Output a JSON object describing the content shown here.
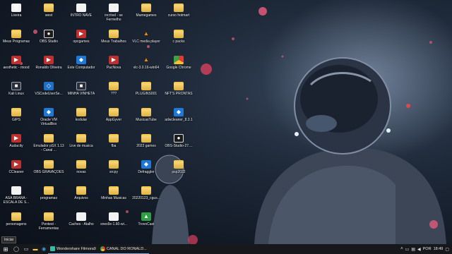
{
  "desktop": {
    "icons": [
      {
        "label": "Lixeira",
        "type": "file",
        "glyph": "🗑"
      },
      {
        "label": "Meus Programas",
        "type": "folder"
      },
      {
        "label": "aesthetic - mood",
        "type": "app-red"
      },
      {
        "label": "Kali Linux",
        "type": "app-dark"
      },
      {
        "label": "GIPS",
        "type": "folder"
      },
      {
        "label": "Audacity",
        "type": "app-red"
      },
      {
        "label": "CCleaner",
        "type": "app-red"
      },
      {
        "label": "ASA BRANA - ESCALA DE S...",
        "type": "file"
      },
      {
        "label": "personagens",
        "type": "folder"
      },
      {
        "label": "west",
        "type": "folder"
      },
      {
        "label": "OBS Studio",
        "type": "obs"
      },
      {
        "label": "Ronaldo Oliveira",
        "type": "app-red"
      },
      {
        "label": "VSCodeUserSe...",
        "type": "vscode"
      },
      {
        "label": "Oracle VM VirtualBox",
        "type": "app-blue"
      },
      {
        "label": "Emulador pSX 1.13 - Canal ...",
        "type": "folder"
      },
      {
        "label": "OBS GRAVAÇÕES",
        "type": "folder"
      },
      {
        "label": "programas",
        "type": "folder"
      },
      {
        "label": "Pentest - Ferramentas",
        "type": "folder"
      },
      {
        "label": "INTRO NAVE",
        "type": "file"
      },
      {
        "label": "opcgames",
        "type": "app-red"
      },
      {
        "label": "Este Computador",
        "type": "app-blue"
      },
      {
        "label": "MINHA VINHETA",
        "type": "app-dark"
      },
      {
        "label": "kodular",
        "type": "folder"
      },
      {
        "label": "Live de musica",
        "type": "folder"
      },
      {
        "label": "novas",
        "type": "folder"
      },
      {
        "label": "Arquivos",
        "type": "folder"
      },
      {
        "label": "Caches - Atalho",
        "type": "file"
      },
      {
        "label": "incrível - se Fermelho",
        "type": "file"
      },
      {
        "label": "Meus Trabalhos",
        "type": "folder"
      },
      {
        "label": "PacNova",
        "type": "app-red"
      },
      {
        "label": "???",
        "type": "folder"
      },
      {
        "label": "AppGyver",
        "type": "folder"
      },
      {
        "label": "fba",
        "type": "folder"
      },
      {
        "label": "srcpy",
        "type": "folder"
      },
      {
        "label": "Minhas Musicas",
        "type": "folder"
      },
      {
        "label": "snes9x-1.60-wi...",
        "type": "file"
      },
      {
        "label": "Mamegames",
        "type": "folder"
      },
      {
        "label": "VLC media player",
        "type": "vlc"
      },
      {
        "label": "vlc-3.0.16-win64",
        "type": "vlc"
      },
      {
        "label": "PLUGINS001",
        "type": "folder"
      },
      {
        "label": "MusicasTube",
        "type": "folder"
      },
      {
        "label": "2022 games",
        "type": "folder"
      },
      {
        "label": "Defraggler",
        "type": "app-blue"
      },
      {
        "label": "20220123_cgus...",
        "type": "folder"
      },
      {
        "label": "TrovoCast",
        "type": "app-green"
      },
      {
        "label": "curso hotmart",
        "type": "folder"
      },
      {
        "label": "c packs",
        "type": "folder"
      },
      {
        "label": "Google Chrome",
        "type": "chrome"
      },
      {
        "label": "NFT'S PRONTAS",
        "type": "folder"
      },
      {
        "label": "adwcleaner_8.3.1",
        "type": "app-blue"
      },
      {
        "label": "OBS-Studio-27....",
        "type": "obs"
      },
      {
        "label": "psp2022",
        "type": "folder"
      }
    ]
  },
  "taskbar": {
    "tooltip": "Iniciar",
    "apps": [
      {
        "label": "Wondershare Filmora9",
        "color": "#2cc0a8"
      },
      {
        "label": "CANAL DO RONALD...",
        "color": "#e8a020"
      }
    ],
    "tray": {
      "language": "POR",
      "time": "18:49"
    }
  },
  "colors": {
    "taskbar_bg": "#16181c",
    "accent": "#7aa7e0"
  }
}
